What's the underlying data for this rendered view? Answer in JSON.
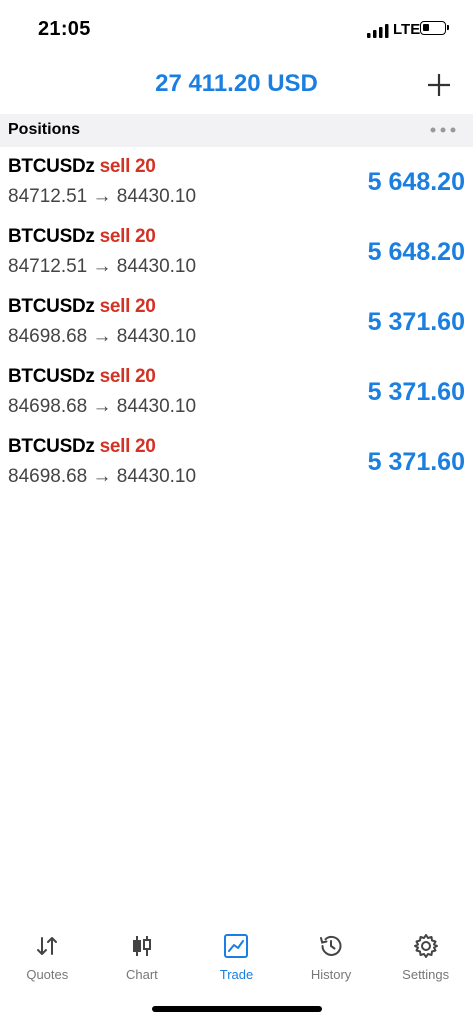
{
  "status": {
    "time": "21:05",
    "carrier": "LTE"
  },
  "header": {
    "balance": "27 411.20 USD"
  },
  "section": {
    "title": "Positions"
  },
  "positions": [
    {
      "symbol": "BTCUSDz",
      "side": "sell 20",
      "prices": "84712.51 → 84430.10",
      "profit": "5 648.20"
    },
    {
      "symbol": "BTCUSDz",
      "side": "sell 20",
      "prices": "84712.51 → 84430.10",
      "profit": "5 648.20"
    },
    {
      "symbol": "BTCUSDz",
      "side": "sell 20",
      "prices": "84698.68 → 84430.10",
      "profit": "5 371.60"
    },
    {
      "symbol": "BTCUSDz",
      "side": "sell 20",
      "prices": "84698.68 → 84430.10",
      "profit": "5 371.60"
    },
    {
      "symbol": "BTCUSDz",
      "side": "sell 20",
      "prices": "84698.68 → 84430.10",
      "profit": "5 371.60"
    }
  ],
  "tabs": [
    {
      "label": "Quotes",
      "icon": "quotes-arrows-icon"
    },
    {
      "label": "Chart",
      "icon": "candlestick-icon"
    },
    {
      "label": "Trade",
      "icon": "trend-line-icon",
      "active": true
    },
    {
      "label": "History",
      "icon": "history-clock-icon"
    },
    {
      "label": "Settings",
      "icon": "gear-icon"
    }
  ],
  "colors": {
    "accent": "#1a7fe0",
    "sell": "#d33224"
  }
}
